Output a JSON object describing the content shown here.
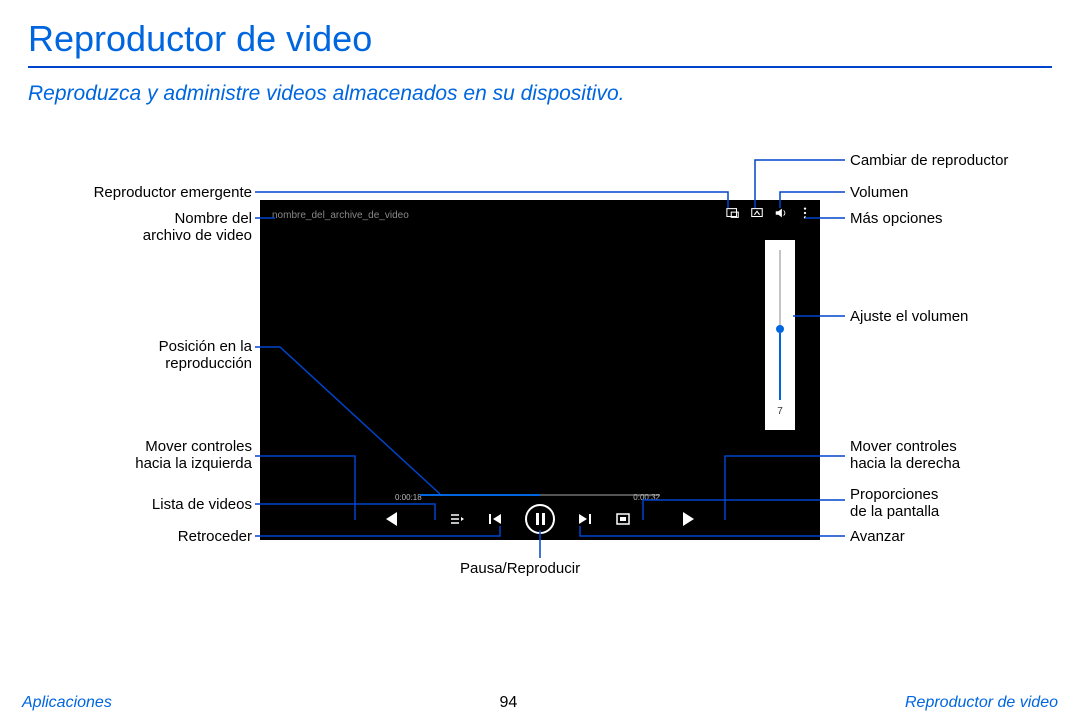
{
  "title": "Reproductor de video",
  "subtitle": "Reproduzca y administre videos almacenados en su dispositivo.",
  "player": {
    "filename": "nombre_del_archive_de_video",
    "time_elapsed": "0:00:18",
    "time_total": "0:00:32",
    "volume_value": "7"
  },
  "callouts": {
    "left": {
      "popup": "Reproductor emergente",
      "filename_a": "Nombre del",
      "filename_b": "archivo de video",
      "position_a": "Posición en la",
      "position_b": "reproducción",
      "moveleft_a": "Mover controles",
      "moveleft_b": "hacia la izquierda",
      "list": "Lista de videos",
      "rewind": "Retroceder"
    },
    "right": {
      "switch": "Cambiar de reproductor",
      "volume": "Volumen",
      "more": "Más opciones",
      "adjust": "Ajuste el volumen",
      "moveright_a": "Mover controles",
      "moveright_b": "hacia la derecha",
      "ratio_a": "Proporciones",
      "ratio_b": "de la pantalla",
      "forward": "Avanzar"
    },
    "bottom": {
      "pause": "Pausa/Reproducir"
    }
  },
  "footer": {
    "left": "Aplicaciones",
    "page": "94",
    "right": "Reproductor de video"
  }
}
